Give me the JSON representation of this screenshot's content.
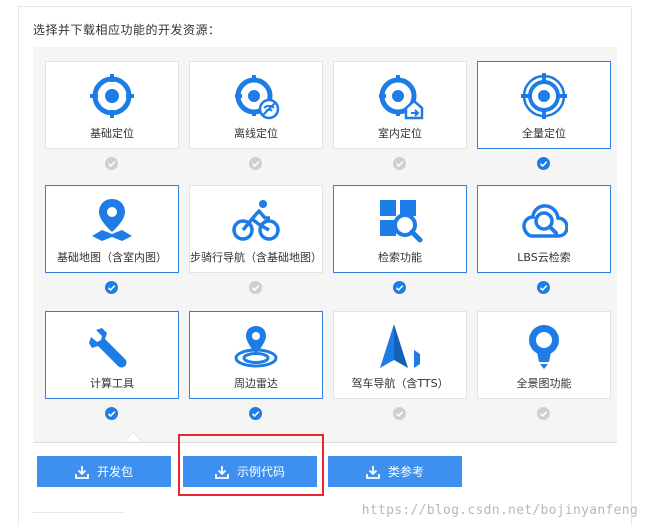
{
  "header": {
    "title": "选择并下载相应功能的开发资源："
  },
  "colors": {
    "accent": "#1d7ce5",
    "button": "#3d8ff0",
    "unchecked": "#cfcfcf",
    "highlight": "#e8262d"
  },
  "cards": [
    {
      "label": "基础定位",
      "icon": "target-icon",
      "checked": false,
      "selected": false
    },
    {
      "label": "离线定位",
      "icon": "target-offline-icon",
      "checked": false,
      "selected": false
    },
    {
      "label": "室内定位",
      "icon": "target-indoor-icon",
      "checked": false,
      "selected": false
    },
    {
      "label": "全量定位",
      "icon": "target-full-icon",
      "checked": true,
      "selected": true
    },
    {
      "label": "基础地图（含室内图）",
      "icon": "map-pin-icon",
      "checked": true,
      "selected": true
    },
    {
      "label": "步骑行导航（含基础地图）",
      "icon": "bicycle-icon",
      "checked": false,
      "selected": false
    },
    {
      "label": "检索功能",
      "icon": "search-grid-icon",
      "checked": true,
      "selected": true
    },
    {
      "label": "LBS云检索",
      "icon": "cloud-search-icon",
      "checked": true,
      "selected": true
    },
    {
      "label": "计算工具",
      "icon": "wrench-icon",
      "checked": true,
      "selected": true
    },
    {
      "label": "周边雷达",
      "icon": "radar-icon",
      "checked": true,
      "selected": true
    },
    {
      "label": "驾车导航（含TTS）",
      "icon": "navigation-arrow-icon",
      "checked": false,
      "selected": false
    },
    {
      "label": "全景图功能",
      "icon": "panorama-icon",
      "checked": false,
      "selected": false
    }
  ],
  "buttons": {
    "dev_pack": "开发包",
    "sample_code": "示例代码",
    "reference": "类参考"
  },
  "watermark": "https://blog.csdn.net/bojinyanfeng"
}
